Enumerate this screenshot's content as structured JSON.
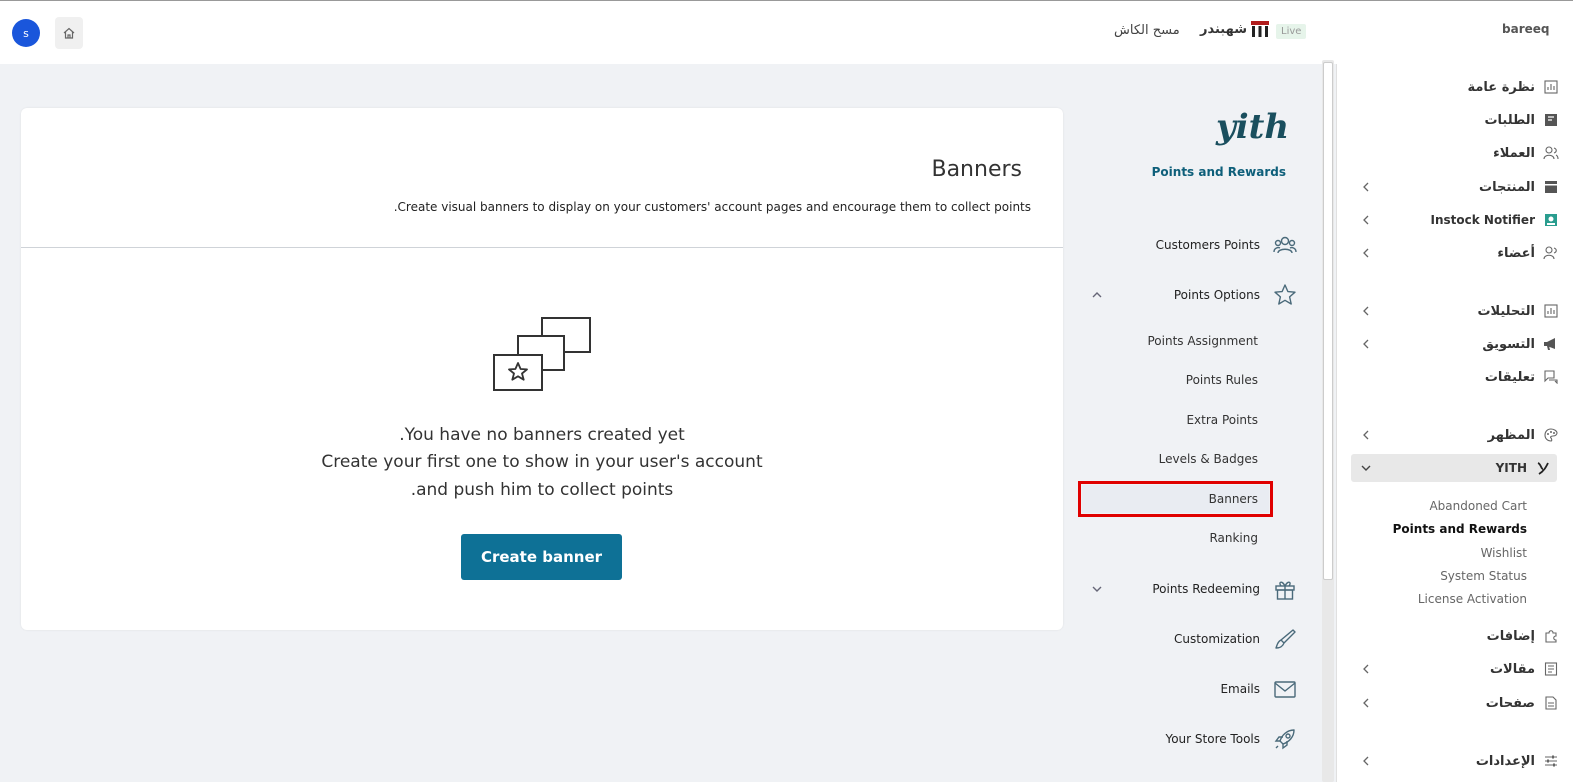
{
  "topbar": {
    "avatar_letter": "s",
    "clear_cache": "مسح الكاش",
    "shahbandar": "شهبندر",
    "live": "Live",
    "site_name": "bareeq"
  },
  "sidebar": {
    "items": [
      {
        "label": "نظرة عامة",
        "icon": "chart-icon",
        "chevron": false
      },
      {
        "label": "الطلبات",
        "icon": "orders-icon",
        "chevron": false
      },
      {
        "label": "العملاء",
        "icon": "customers-icon",
        "chevron": false
      },
      {
        "label": "المنتجات",
        "icon": "products-icon",
        "chevron": true
      },
      {
        "label": "Instock Notifier",
        "icon": "notifier-icon",
        "chevron": true
      },
      {
        "label": "أعضاء",
        "icon": "members-icon",
        "chevron": true
      },
      {
        "label": "التحليلات",
        "icon": "analytics-icon",
        "chevron": true
      },
      {
        "label": "التسويق",
        "icon": "megaphone-icon",
        "chevron": true
      },
      {
        "label": "تعليقات",
        "icon": "comments-icon",
        "chevron": false
      },
      {
        "label": "المظهر",
        "icon": "palette-icon",
        "chevron": true
      },
      {
        "label": "YITH",
        "icon": "yith-icon",
        "chevron": true
      },
      {
        "label": "إضافات",
        "icon": "puzzle-icon",
        "chevron": false
      },
      {
        "label": "مقالات",
        "icon": "posts-icon",
        "chevron": true
      },
      {
        "label": "صفحات",
        "icon": "pages-icon",
        "chevron": true
      },
      {
        "label": "الإعدادات",
        "icon": "settings-icon",
        "chevron": true
      }
    ],
    "yith_sub": [
      "Abandoned Cart",
      "Points and Rewards",
      "Wishlist",
      "System Status",
      "License Activation"
    ]
  },
  "plugin_nav": {
    "logo_text": "yith",
    "title": "Points and Rewards",
    "items": [
      {
        "label": "Customers Points",
        "icon": "users-icon"
      },
      {
        "label": "Points Options",
        "icon": "star-icon"
      },
      {
        "label": "Points Redeeming",
        "icon": "gift-icon"
      },
      {
        "label": "Customization",
        "icon": "brush-icon"
      },
      {
        "label": "Emails",
        "icon": "mail-icon"
      },
      {
        "label": "Your Store Tools",
        "icon": "rocket-icon"
      }
    ],
    "sub_items": [
      "Points Assignment",
      "Points Rules",
      "Extra Points",
      "Levels & Badges",
      "Banners",
      "Ranking"
    ]
  },
  "main": {
    "title": "Banners",
    "description": "Create visual banners to display on your customers' account pages and encourage them to collect points.",
    "empty_lines": [
      "You have no banners created yet.",
      "Create your first one to show in your user's account",
      "and push him to collect points."
    ],
    "create_button": "Create banner"
  }
}
